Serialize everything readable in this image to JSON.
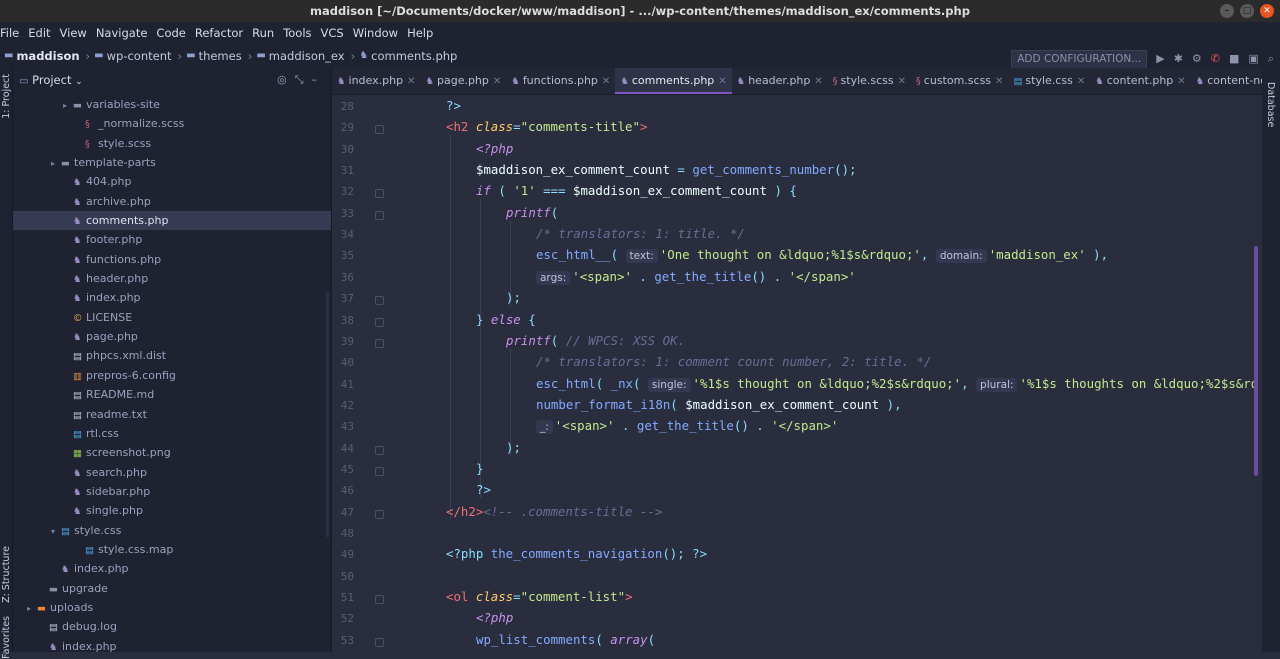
{
  "window": {
    "title": "maddison [~/Documents/docker/www/maddison] - .../wp-content/themes/maddison_ex/comments.php"
  },
  "menu": [
    "File",
    "Edit",
    "View",
    "Navigate",
    "Code",
    "Refactor",
    "Run",
    "Tools",
    "VCS",
    "Window",
    "Help"
  ],
  "breadcrumbs": [
    "maddison",
    "wp-content",
    "themes",
    "maddison_ex",
    "comments.php"
  ],
  "toolbar": {
    "add_config": "ADD CONFIGURATION..."
  },
  "side_tabs": {
    "project": "1: Project",
    "structure": "Z: Structure",
    "favorites": "Favorites",
    "database": "Database"
  },
  "project_panel": {
    "title": "Project"
  },
  "tree": [
    {
      "label": "variables-site",
      "indent": 4,
      "arrow": "▸",
      "icon": "dir"
    },
    {
      "label": "_normalize.scss",
      "indent": 5,
      "arrow": "",
      "icon": "scss"
    },
    {
      "label": "style.scss",
      "indent": 5,
      "arrow": "",
      "icon": "scss"
    },
    {
      "label": "template-parts",
      "indent": 3,
      "arrow": "▸",
      "icon": "dir"
    },
    {
      "label": "404.php",
      "indent": 4,
      "arrow": "",
      "icon": "php"
    },
    {
      "label": "archive.php",
      "indent": 4,
      "arrow": "",
      "icon": "php"
    },
    {
      "label": "comments.php",
      "indent": 4,
      "arrow": "",
      "icon": "php",
      "selected": true
    },
    {
      "label": "footer.php",
      "indent": 4,
      "arrow": "",
      "icon": "php"
    },
    {
      "label": "functions.php",
      "indent": 4,
      "arrow": "",
      "icon": "php"
    },
    {
      "label": "header.php",
      "indent": 4,
      "arrow": "",
      "icon": "php"
    },
    {
      "label": "index.php",
      "indent": 4,
      "arrow": "",
      "icon": "php"
    },
    {
      "label": "LICENSE",
      "indent": 4,
      "arrow": "",
      "icon": "lic"
    },
    {
      "label": "page.php",
      "indent": 4,
      "arrow": "",
      "icon": "php"
    },
    {
      "label": "phpcs.xml.dist",
      "indent": 4,
      "arrow": "",
      "icon": "doc"
    },
    {
      "label": "prepros-6.config",
      "indent": 4,
      "arrow": "",
      "icon": "cfg"
    },
    {
      "label": "README.md",
      "indent": 4,
      "arrow": "",
      "icon": "doc"
    },
    {
      "label": "readme.txt",
      "indent": 4,
      "arrow": "",
      "icon": "doc"
    },
    {
      "label": "rtl.css",
      "indent": 4,
      "arrow": "",
      "icon": "css"
    },
    {
      "label": "screenshot.png",
      "indent": 4,
      "arrow": "",
      "icon": "img"
    },
    {
      "label": "search.php",
      "indent": 4,
      "arrow": "",
      "icon": "php"
    },
    {
      "label": "sidebar.php",
      "indent": 4,
      "arrow": "",
      "icon": "php"
    },
    {
      "label": "single.php",
      "indent": 4,
      "arrow": "",
      "icon": "php"
    },
    {
      "label": "style.css",
      "indent": 3,
      "arrow": "▾",
      "icon": "css"
    },
    {
      "label": "style.css.map",
      "indent": 5,
      "arrow": "",
      "icon": "css"
    },
    {
      "label": "index.php",
      "indent": 3,
      "arrow": "",
      "icon": "php"
    },
    {
      "label": "upgrade",
      "indent": 2,
      "arrow": "",
      "icon": "dir"
    },
    {
      "label": "uploads",
      "indent": 1,
      "arrow": "▸",
      "icon": "upl"
    },
    {
      "label": "debug.log",
      "indent": 2,
      "arrow": "",
      "icon": "doc"
    },
    {
      "label": "index.php",
      "indent": 2,
      "arrow": "",
      "icon": "php"
    }
  ],
  "tabs": [
    {
      "label": "index.php",
      "icon": "php"
    },
    {
      "label": "page.php",
      "icon": "php"
    },
    {
      "label": "functions.php",
      "icon": "php"
    },
    {
      "label": "comments.php",
      "icon": "php",
      "active": true
    },
    {
      "label": "header.php",
      "icon": "php"
    },
    {
      "label": "style.scss",
      "icon": "scss"
    },
    {
      "label": "custom.scss",
      "icon": "scss"
    },
    {
      "label": "style.css",
      "icon": "css"
    },
    {
      "label": "content.php",
      "icon": "php"
    },
    {
      "label": "content-none.php",
      "icon": "php"
    }
  ],
  "line_numbers": [
    "28",
    "29",
    "30",
    "31",
    "32",
    "33",
    "34",
    "35",
    "36",
    "37",
    "38",
    "39",
    "40",
    "41",
    "42",
    "43",
    "44",
    "45",
    "46",
    "47",
    "48",
    "49",
    "50",
    "51",
    "52",
    "53"
  ],
  "code_lines": [
    {
      "indent": 0,
      "parts": [
        [
          "p",
          "?>"
        ]
      ]
    },
    {
      "indent": 0,
      "parts": [
        [
          "tag",
          "<h2 "
        ],
        [
          "a",
          "class"
        ],
        [
          "p",
          "="
        ],
        [
          "s",
          "\"comments-title\""
        ],
        [
          "tag",
          ">"
        ]
      ]
    },
    {
      "indent": 1,
      "parts": [
        [
          "ki",
          "<?php"
        ]
      ]
    },
    {
      "indent": 1,
      "parts": [
        [
          "v",
          "$maddison_ex_comment_count"
        ],
        [
          "p",
          " = "
        ],
        [
          "f",
          "get_comments_number"
        ],
        [
          "p",
          "();"
        ]
      ]
    },
    {
      "indent": 1,
      "parts": [
        [
          "ki",
          "if"
        ],
        [
          "p",
          " ( "
        ],
        [
          "s",
          "'1'"
        ],
        [
          "p",
          " === "
        ],
        [
          "v",
          "$maddison_ex_comment_count"
        ],
        [
          "p",
          " ) {"
        ]
      ]
    },
    {
      "indent": 2,
      "parts": [
        [
          "ki",
          "printf"
        ],
        [
          "p",
          "("
        ]
      ]
    },
    {
      "indent": 3,
      "parts": [
        [
          "c",
          "/* translators: 1: title. */"
        ]
      ]
    },
    {
      "indent": 3,
      "parts": [
        [
          "f",
          "esc_html__"
        ],
        [
          "p",
          "( "
        ],
        [
          "hint",
          "text:"
        ],
        [
          "s",
          "'One thought on &ldquo;%1$s&rdquo;'"
        ],
        [
          "p",
          ", "
        ],
        [
          "hint",
          "domain:"
        ],
        [
          "s",
          "'maddison_ex'"
        ],
        [
          "p",
          " ),"
        ]
      ]
    },
    {
      "indent": 3,
      "parts": [
        [
          "hint",
          "args:"
        ],
        [
          "s",
          "'<span>'"
        ],
        [
          "p",
          " . "
        ],
        [
          "f",
          "get_the_title"
        ],
        [
          "p",
          "() . "
        ],
        [
          "s",
          "'</span>'"
        ]
      ]
    },
    {
      "indent": 2,
      "parts": [
        [
          "p",
          ");"
        ]
      ]
    },
    {
      "indent": 1,
      "parts": [
        [
          "p",
          "} "
        ],
        [
          "ki",
          "else"
        ],
        [
          "p",
          " {"
        ]
      ]
    },
    {
      "indent": 2,
      "parts": [
        [
          "ki",
          "printf"
        ],
        [
          "p",
          "( "
        ],
        [
          "c",
          "// WPCS: XSS OK."
        ]
      ]
    },
    {
      "indent": 3,
      "parts": [
        [
          "c",
          "/* translators: 1: comment count number, 2: title. */"
        ]
      ]
    },
    {
      "indent": 3,
      "parts": [
        [
          "f",
          "esc_html"
        ],
        [
          "p",
          "( "
        ],
        [
          "f",
          "_nx"
        ],
        [
          "p",
          "( "
        ],
        [
          "hint",
          "single:"
        ],
        [
          "s",
          "'%1$s thought on &ldquo;%2$s&rdquo;'"
        ],
        [
          "p",
          ", "
        ],
        [
          "hint",
          "plural:"
        ],
        [
          "s",
          "'%1$s thoughts on &ldquo;%2$s&rd"
        ]
      ]
    },
    {
      "indent": 3,
      "parts": [
        [
          "f",
          "number_format_i18n"
        ],
        [
          "p",
          "( "
        ],
        [
          "v",
          "$maddison_ex_comment_count"
        ],
        [
          "p",
          " ),"
        ]
      ]
    },
    {
      "indent": 3,
      "parts": [
        [
          "hint",
          "_:"
        ],
        [
          "s",
          "'<span>'"
        ],
        [
          "p",
          " . "
        ],
        [
          "f",
          "get_the_title"
        ],
        [
          "p",
          "() . "
        ],
        [
          "s",
          "'</span>'"
        ]
      ]
    },
    {
      "indent": 2,
      "parts": [
        [
          "p",
          ");"
        ]
      ]
    },
    {
      "indent": 1,
      "parts": [
        [
          "p",
          "}"
        ]
      ]
    },
    {
      "indent": 1,
      "parts": [
        [
          "p",
          "?>"
        ]
      ]
    },
    {
      "indent": 0,
      "parts": [
        [
          "tag",
          "</h2>"
        ],
        [
          "c",
          "<!-- .comments-title -->"
        ]
      ]
    },
    {
      "indent": 0,
      "parts": []
    },
    {
      "indent": 0,
      "parts": [
        [
          "p",
          "<?php "
        ],
        [
          "f",
          "the_comments_navigation"
        ],
        [
          "p",
          "(); ?>"
        ]
      ]
    },
    {
      "indent": 0,
      "parts": []
    },
    {
      "indent": 0,
      "parts": [
        [
          "tag",
          "<ol "
        ],
        [
          "a",
          "class"
        ],
        [
          "p",
          "="
        ],
        [
          "s",
          "\"comment-list\""
        ],
        [
          "tag",
          ">"
        ]
      ]
    },
    {
      "indent": 1,
      "parts": [
        [
          "ki",
          "<?php"
        ]
      ]
    },
    {
      "indent": 1,
      "parts": [
        [
          "f",
          "wp_list_comments"
        ],
        [
          "p",
          "( "
        ],
        [
          "ki",
          "array"
        ],
        [
          "p",
          "("
        ]
      ]
    }
  ]
}
